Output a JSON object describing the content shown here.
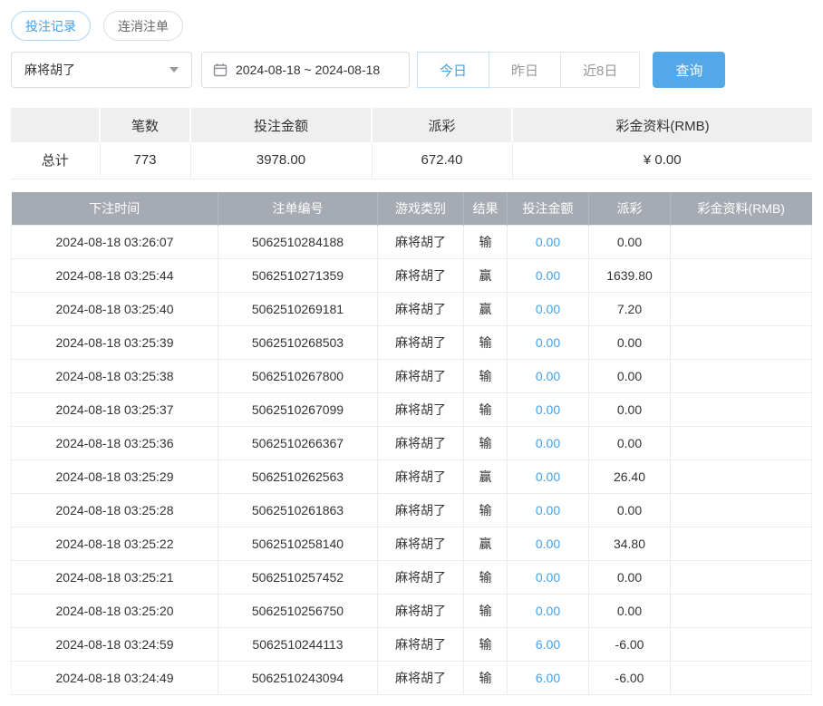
{
  "colors": {
    "accent": "#45a0e6",
    "primary_button_bg": "#55a8e8",
    "table_header_bg": "#a6aab2",
    "negative_value": "#e05a5a"
  },
  "tabs": [
    {
      "label": "投注记录",
      "active": true
    },
    {
      "label": "连消注单",
      "active": false
    }
  ],
  "filters": {
    "game_select": {
      "value": "麻将胡了"
    },
    "date_range": "2024-08-18 ~ 2024-08-18",
    "quick_buttons": [
      {
        "label": "今日",
        "active": true
      },
      {
        "label": "昨日",
        "active": false
      },
      {
        "label": "近8日",
        "active": false
      }
    ],
    "search_label": "查询"
  },
  "summary": {
    "headers": [
      "",
      "笔数",
      "投注金额",
      "派彩",
      "彩金资料(RMB)"
    ],
    "row": {
      "label": "总计",
      "count": "773",
      "bet_amount": "3978.00",
      "payout": "672.40",
      "bonus": "¥ 0.00"
    }
  },
  "table": {
    "headers": [
      "下注时间",
      "注单编号",
      "游戏类别",
      "结果",
      "投注金额",
      "派彩",
      "彩金资料(RMB)"
    ],
    "rows": [
      {
        "time": "2024-08-18 03:26:07",
        "id": "5062510284188",
        "game": "麻将胡了",
        "result": "输",
        "bet": "0.00",
        "payout": "0.00",
        "bonus": ""
      },
      {
        "time": "2024-08-18 03:25:44",
        "id": "5062510271359",
        "game": "麻将胡了",
        "result": "赢",
        "bet": "0.00",
        "payout": "1639.80",
        "bonus": ""
      },
      {
        "time": "2024-08-18 03:25:40",
        "id": "5062510269181",
        "game": "麻将胡了",
        "result": "赢",
        "bet": "0.00",
        "payout": "7.20",
        "bonus": ""
      },
      {
        "time": "2024-08-18 03:25:39",
        "id": "5062510268503",
        "game": "麻将胡了",
        "result": "输",
        "bet": "0.00",
        "payout": "0.00",
        "bonus": ""
      },
      {
        "time": "2024-08-18 03:25:38",
        "id": "5062510267800",
        "game": "麻将胡了",
        "result": "输",
        "bet": "0.00",
        "payout": "0.00",
        "bonus": ""
      },
      {
        "time": "2024-08-18 03:25:37",
        "id": "5062510267099",
        "game": "麻将胡了",
        "result": "输",
        "bet": "0.00",
        "payout": "0.00",
        "bonus": ""
      },
      {
        "time": "2024-08-18 03:25:36",
        "id": "5062510266367",
        "game": "麻将胡了",
        "result": "输",
        "bet": "0.00",
        "payout": "0.00",
        "bonus": ""
      },
      {
        "time": "2024-08-18 03:25:29",
        "id": "5062510262563",
        "game": "麻将胡了",
        "result": "赢",
        "bet": "0.00",
        "payout": "26.40",
        "bonus": ""
      },
      {
        "time": "2024-08-18 03:25:28",
        "id": "5062510261863",
        "game": "麻将胡了",
        "result": "输",
        "bet": "0.00",
        "payout": "0.00",
        "bonus": ""
      },
      {
        "time": "2024-08-18 03:25:22",
        "id": "5062510258140",
        "game": "麻将胡了",
        "result": "赢",
        "bet": "0.00",
        "payout": "34.80",
        "bonus": ""
      },
      {
        "time": "2024-08-18 03:25:21",
        "id": "5062510257452",
        "game": "麻将胡了",
        "result": "输",
        "bet": "0.00",
        "payout": "0.00",
        "bonus": ""
      },
      {
        "time": "2024-08-18 03:25:20",
        "id": "5062510256750",
        "game": "麻将胡了",
        "result": "输",
        "bet": "0.00",
        "payout": "0.00",
        "bonus": ""
      },
      {
        "time": "2024-08-18 03:24:59",
        "id": "5062510244113",
        "game": "麻将胡了",
        "result": "输",
        "bet": "6.00",
        "payout": "-6.00",
        "bonus": ""
      },
      {
        "time": "2024-08-18 03:24:49",
        "id": "5062510243094",
        "game": "麻将胡了",
        "result": "输",
        "bet": "6.00",
        "payout": "-6.00",
        "bonus": ""
      }
    ]
  }
}
